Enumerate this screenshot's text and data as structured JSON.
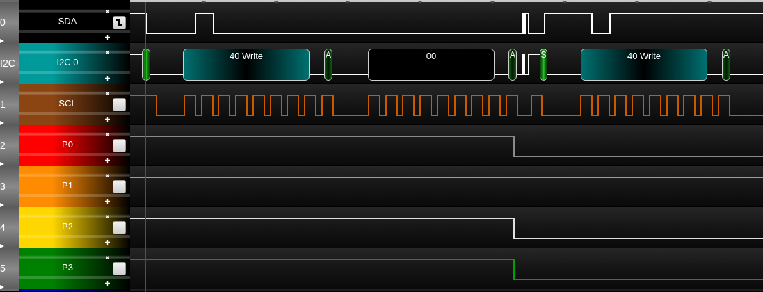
{
  "channels": [
    {
      "index": "0",
      "name": "SDA",
      "kind": "digital",
      "color": "#000000",
      "trace": {
        "color": "#ffffff"
      },
      "edge_trigger": true
    },
    {
      "index": "I2C",
      "name": "I2C 0",
      "kind": "analyzer",
      "color": "#009a9a",
      "trace": {
        "color": "#ffffff"
      },
      "frames": [
        {
          "kind": "start"
        },
        {
          "kind": "address",
          "label": "40 Write"
        },
        {
          "kind": "ack",
          "label": "A"
        },
        {
          "kind": "data",
          "label": "00"
        },
        {
          "kind": "ack",
          "label": "A"
        },
        {
          "kind": "start",
          "label": "S"
        },
        {
          "kind": "address",
          "label": "40 Write"
        },
        {
          "kind": "ack",
          "label": "A"
        }
      ]
    },
    {
      "index": "1",
      "name": "SCL",
      "kind": "digital",
      "color": "#8b4513",
      "trace": {
        "color": "#c85a00"
      },
      "edge_trigger": false
    },
    {
      "index": "2",
      "name": "P0",
      "kind": "digital",
      "color": "#ff0000",
      "trace": {
        "color": "#8a8a8a"
      },
      "edge_trigger": false
    },
    {
      "index": "3",
      "name": "P1",
      "kind": "digital",
      "color": "#ff8c00",
      "trace": {
        "color": "#ff8c00"
      },
      "edge_trigger": false
    },
    {
      "index": "4",
      "name": "P2",
      "kind": "digital",
      "color": "#ffd700",
      "trace": {
        "color": "#e0e0e0"
      },
      "edge_trigger": false
    },
    {
      "index": "5",
      "name": "P3",
      "kind": "digital",
      "color": "#008000",
      "trace": {
        "color": "#00a000"
      },
      "edge_trigger": false
    },
    {
      "kind": "partial",
      "color": "#0000c0"
    }
  ]
}
